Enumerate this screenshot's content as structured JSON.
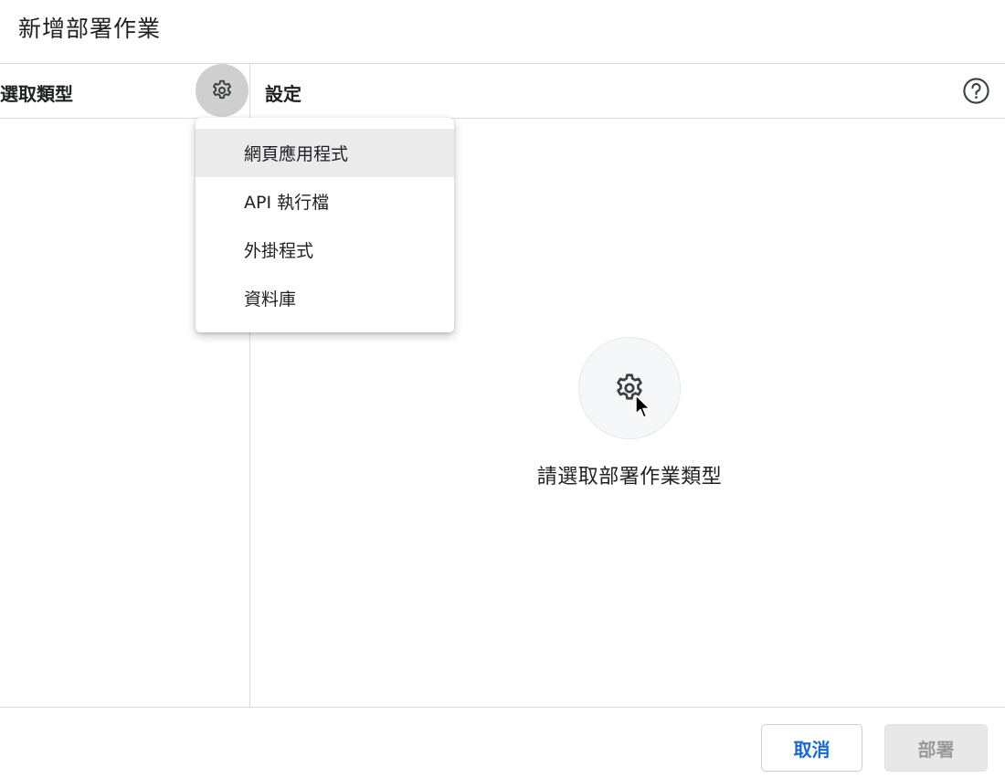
{
  "dialog": {
    "title": "新增部署作業"
  },
  "left_panel": {
    "title": "選取類型"
  },
  "right_panel": {
    "title": "設定"
  },
  "type_menu": {
    "items": [
      {
        "label": "網頁應用程式"
      },
      {
        "label": "API 執行檔"
      },
      {
        "label": "外掛程式"
      },
      {
        "label": "資料庫"
      }
    ]
  },
  "empty_state": {
    "message": "請選取部署作業類型"
  },
  "footer": {
    "cancel_label": "取消",
    "deploy_label": "部署"
  },
  "icons": {
    "type_selector": "gear-icon",
    "help": "help-icon",
    "empty_state": "gear-icon",
    "pointer": "cursor-icon"
  },
  "colors": {
    "accent": "#1a67d2",
    "disabled_text": "#9a9a9a",
    "divider": "#d9d9d9"
  }
}
